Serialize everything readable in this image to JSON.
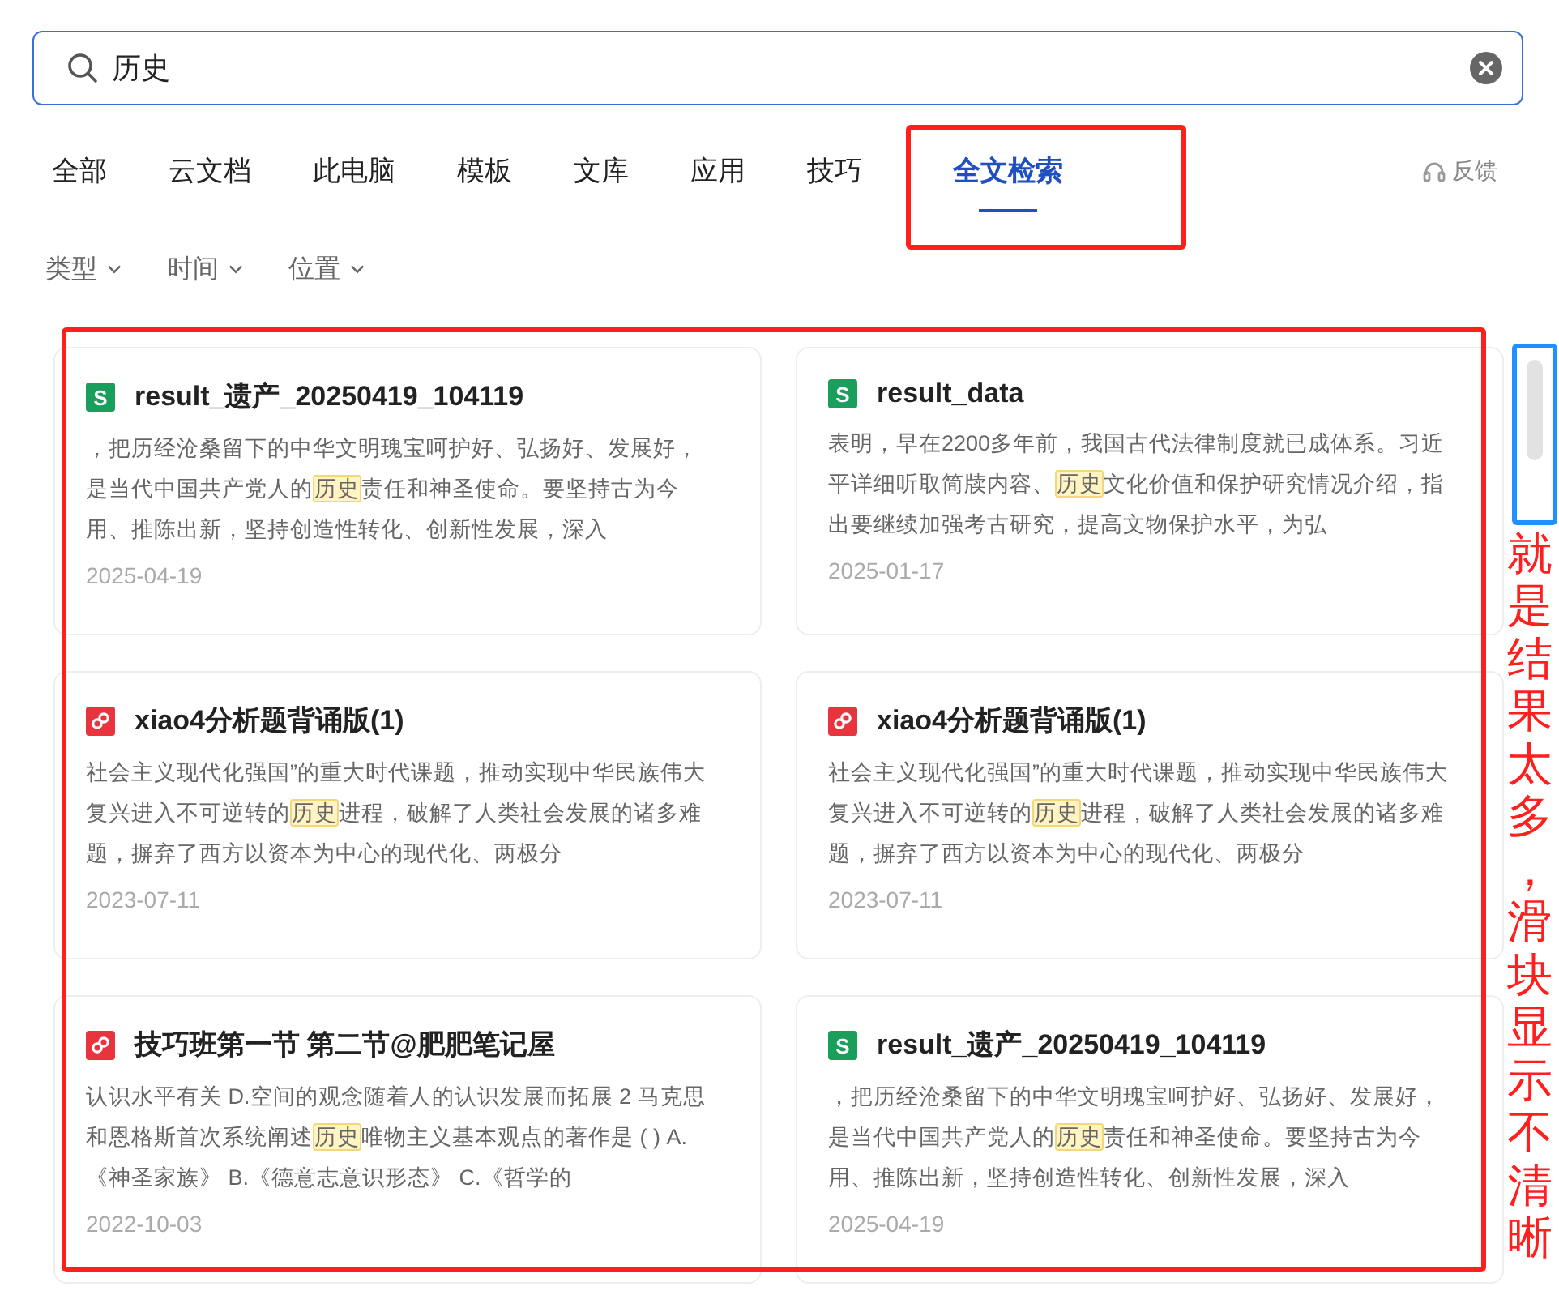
{
  "search": {
    "value": "历史"
  },
  "tabs": [
    {
      "label": "全部",
      "selected": false
    },
    {
      "label": "云文档",
      "selected": false
    },
    {
      "label": "此电脑",
      "selected": false
    },
    {
      "label": "模板",
      "selected": false
    },
    {
      "label": "文库",
      "selected": false
    },
    {
      "label": "应用",
      "selected": false
    },
    {
      "label": "技巧",
      "selected": false
    },
    {
      "label": "全文检索",
      "selected": true
    }
  ],
  "feedback": {
    "label": "反馈"
  },
  "filters": [
    {
      "label": "类型"
    },
    {
      "label": "时间"
    },
    {
      "label": "位置"
    }
  ],
  "results": [
    {
      "kind": "sheet",
      "icon_letter": "S",
      "title": "result_遗产_20250419_104119",
      "text_before": "，把历经沧桑留下的中华文明瑰宝呵护好、弘扬好、发展好，是当代中国共产党人的",
      "highlight": "历史",
      "text_after": "责任和神圣使命。要坚持古为今用、推陈出新，坚持创造性转化、创新性发展，深入",
      "date": "2025-04-19"
    },
    {
      "kind": "sheet",
      "icon_letter": "S",
      "title": "result_data",
      "text_before": "表明，早在2200多年前，我国古代法律制度就已成体系。习近平详细听取简牍内容、",
      "highlight": "历史",
      "text_after": "文化价值和保护研究情况介绍，指出要继续加强考古研究，提高文物保护水平，为弘",
      "date": "2025-01-17"
    },
    {
      "kind": "pdf",
      "title": "xiao4分析题背诵版(1)",
      "text_before": "社会主义现代化强国”的重大时代课题，推动实现中华民族伟大复兴进入不可逆转的",
      "highlight": "历史",
      "text_after": "进程，破解了人类社会发展的诸多难题，摒弃了西方以资本为中心的现代化、两极分",
      "date": "2023-07-11"
    },
    {
      "kind": "pdf",
      "title": "xiao4分析题背诵版(1)",
      "text_before": "社会主义现代化强国”的重大时代课题，推动实现中华民族伟大复兴进入不可逆转的",
      "highlight": "历史",
      "text_after": "进程，破解了人类社会发展的诸多难题，摒弃了西方以资本为中心的现代化、两极分",
      "date": "2023-07-11"
    },
    {
      "kind": "pdf",
      "title": "技巧班第一节 第二节@肥肥笔记屋",
      "text_before": "认识水平有关 D.空间的观念随着人的认识发展而拓展 2 马克思和恩格斯首次系统阐述",
      "highlight": "历史",
      "text_after": "唯物主义基本观点的著作是 ( ) A.《神圣家族》 B.《德意志意识形态》 C.《哲学的",
      "date": "2022-10-03"
    },
    {
      "kind": "sheet",
      "icon_letter": "S",
      "title": "result_遗产_20250419_104119",
      "text_before": "，把历经沧桑留下的中华文明瑰宝呵护好、弘扬好、发展好，是当代中国共产党人的",
      "highlight": "历史",
      "text_after": "责任和神圣使命。要坚持古为今用、推陈出新，坚持创造性转化、创新性发展，深入",
      "date": "2025-04-19"
    }
  ],
  "annotation": {
    "text": "就是结果太多，滑块显示不清晰"
  }
}
